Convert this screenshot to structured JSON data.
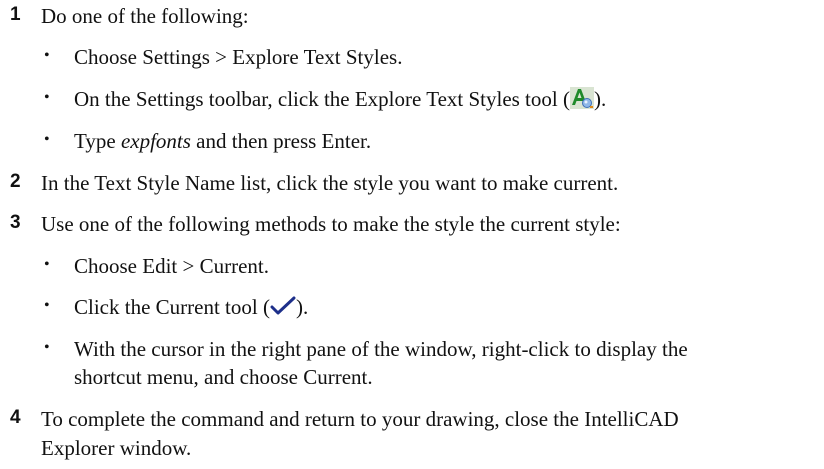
{
  "steps": [
    {
      "number": "1",
      "text": "Do one of the following:",
      "bullets": [
        {
          "text": "Choose Settings > Explore Text Styles."
        },
        {
          "before": "On the Settings toolbar, click the Explore Text Styles tool (",
          "icon": "explore-text-styles-icon",
          "after": ")."
        },
        {
          "italic": "expfonts",
          "before": "Type ",
          "after": " and then press Enter."
        }
      ]
    },
    {
      "number": "2",
      "text": "In the Text Style Name list, click the style you want to make current."
    },
    {
      "number": "3",
      "text": "Use one of the following methods to make the style the current style:",
      "bullets": [
        {
          "text": "Choose Edit > Current."
        },
        {
          "before": "Click the Current tool (",
          "icon": "checkmark-icon",
          "after": ")."
        },
        {
          "line1": "With the cursor in the right pane of the window, right-click to display the",
          "line2": "shortcut menu, and choose Current."
        }
      ]
    },
    {
      "number": "4",
      "line1": "To complete the command and return to your drawing, close the IntelliCAD",
      "line2": "Explorer window."
    }
  ]
}
